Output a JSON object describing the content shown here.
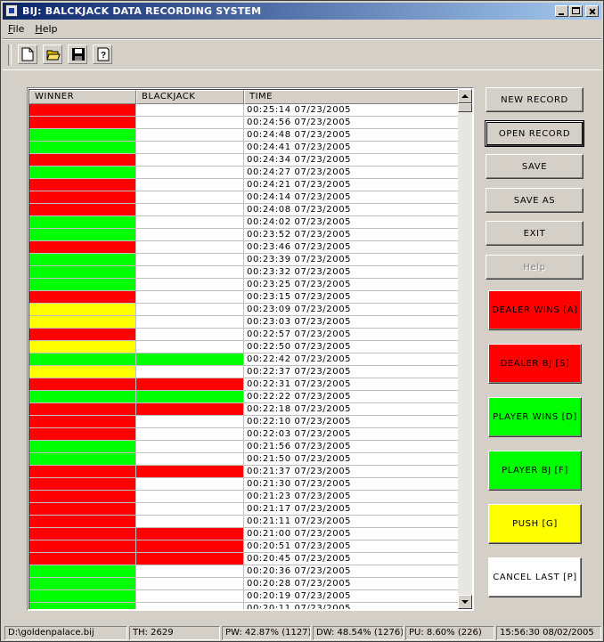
{
  "window": {
    "title": "BIJ: BALCKJACK DATA RECORDING SYSTEM"
  },
  "menu": [
    "File",
    "Help"
  ],
  "toolbar": [
    {
      "name": "new-file-icon"
    },
    {
      "name": "open-folder-icon"
    },
    {
      "name": "save-disk-icon"
    },
    {
      "name": "help-question-icon"
    }
  ],
  "table": {
    "columns": [
      "WINNER",
      "BLACKJACK",
      "TIME"
    ],
    "rows": [
      {
        "winner": "red",
        "blackjack": "",
        "time": "00:25:14 07/23/2005"
      },
      {
        "winner": "red",
        "blackjack": "",
        "time": "00:24:56 07/23/2005"
      },
      {
        "winner": "green",
        "blackjack": "",
        "time": "00:24:48 07/23/2005"
      },
      {
        "winner": "green",
        "blackjack": "",
        "time": "00:24:41 07/23/2005"
      },
      {
        "winner": "red",
        "blackjack": "",
        "time": "00:24:34 07/23/2005"
      },
      {
        "winner": "green",
        "blackjack": "",
        "time": "00:24:27 07/23/2005"
      },
      {
        "winner": "red",
        "blackjack": "",
        "time": "00:24:21 07/23/2005"
      },
      {
        "winner": "red",
        "blackjack": "",
        "time": "00:24:14 07/23/2005"
      },
      {
        "winner": "red",
        "blackjack": "",
        "time": "00:24:08 07/23/2005"
      },
      {
        "winner": "green",
        "blackjack": "",
        "time": "00:24:02 07/23/2005"
      },
      {
        "winner": "green",
        "blackjack": "",
        "time": "00:23:52 07/23/2005"
      },
      {
        "winner": "red",
        "blackjack": "",
        "time": "00:23:46 07/23/2005"
      },
      {
        "winner": "green",
        "blackjack": "",
        "time": "00:23:39 07/23/2005"
      },
      {
        "winner": "green",
        "blackjack": "",
        "time": "00:23:32 07/23/2005"
      },
      {
        "winner": "green",
        "blackjack": "",
        "time": "00:23:25 07/23/2005"
      },
      {
        "winner": "red",
        "blackjack": "",
        "time": "00:23:15 07/23/2005"
      },
      {
        "winner": "yellow",
        "blackjack": "",
        "time": "00:23:09 07/23/2005"
      },
      {
        "winner": "yellow",
        "blackjack": "",
        "time": "00:23:03 07/23/2005"
      },
      {
        "winner": "red",
        "blackjack": "",
        "time": "00:22:57 07/23/2005"
      },
      {
        "winner": "yellow",
        "blackjack": "",
        "time": "00:22:50 07/23/2005"
      },
      {
        "winner": "green",
        "blackjack": "green",
        "time": "00:22:42 07/23/2005"
      },
      {
        "winner": "yellow",
        "blackjack": "",
        "time": "00:22:37 07/23/2005"
      },
      {
        "winner": "red",
        "blackjack": "red",
        "time": "00:22:31 07/23/2005"
      },
      {
        "winner": "green",
        "blackjack": "green",
        "time": "00:22:22 07/23/2005"
      },
      {
        "winner": "red",
        "blackjack": "red",
        "time": "00:22:18 07/23/2005"
      },
      {
        "winner": "red",
        "blackjack": "",
        "time": "00:22:10 07/23/2005"
      },
      {
        "winner": "red",
        "blackjack": "",
        "time": "00:22:03 07/23/2005"
      },
      {
        "winner": "green",
        "blackjack": "",
        "time": "00:21:56 07/23/2005"
      },
      {
        "winner": "green",
        "blackjack": "",
        "time": "00:21:50 07/23/2005"
      },
      {
        "winner": "red",
        "blackjack": "red",
        "time": "00:21:37 07/23/2005"
      },
      {
        "winner": "red",
        "blackjack": "",
        "time": "00:21:30 07/23/2005"
      },
      {
        "winner": "red",
        "blackjack": "",
        "time": "00:21:23 07/23/2005"
      },
      {
        "winner": "red",
        "blackjack": "",
        "time": "00:21:17 07/23/2005"
      },
      {
        "winner": "red",
        "blackjack": "",
        "time": "00:21:11 07/23/2005"
      },
      {
        "winner": "red",
        "blackjack": "red",
        "time": "00:21:00 07/23/2005"
      },
      {
        "winner": "red",
        "blackjack": "red",
        "time": "00:20:51 07/23/2005"
      },
      {
        "winner": "red",
        "blackjack": "red",
        "time": "00:20:45 07/23/2005"
      },
      {
        "winner": "green",
        "blackjack": "",
        "time": "00:20:36 07/23/2005"
      },
      {
        "winner": "green",
        "blackjack": "",
        "time": "00:20:28 07/23/2005"
      },
      {
        "winner": "green",
        "blackjack": "",
        "time": "00:20:19 07/23/2005"
      },
      {
        "winner": "green",
        "blackjack": "",
        "time": "00:20:11 07/23/2005"
      }
    ]
  },
  "buttons": {
    "new_record": "NEW RECORD",
    "open_record": "OPEN RECORD",
    "save": "SAVE",
    "save_as": "SAVE AS",
    "exit": "EXIT",
    "help": "Help",
    "dealer_wins": "DEALER WINS [A]",
    "dealer_bj": "DEALER BJ [S]",
    "player_wins": "PLAYER WINS [D]",
    "player_bj": "PLAYER BJ [F]",
    "push": "PUSH [G]",
    "cancel_last": "CANCEL LAST [P]"
  },
  "colors": {
    "red": "#ff0000",
    "green": "#00ff00",
    "yellow": "#ffff00",
    "white": "#ffffff"
  },
  "status": {
    "file": "D:\\goldenpalace.bij",
    "total_hands": "TH: 2629",
    "player_wins": "PW: 42.87% (1127)",
    "dealer_wins": "DW: 48.54% (1276)",
    "push": "PU: 8.60% (226)",
    "datetime": "15:56:30 08/02/2005"
  }
}
